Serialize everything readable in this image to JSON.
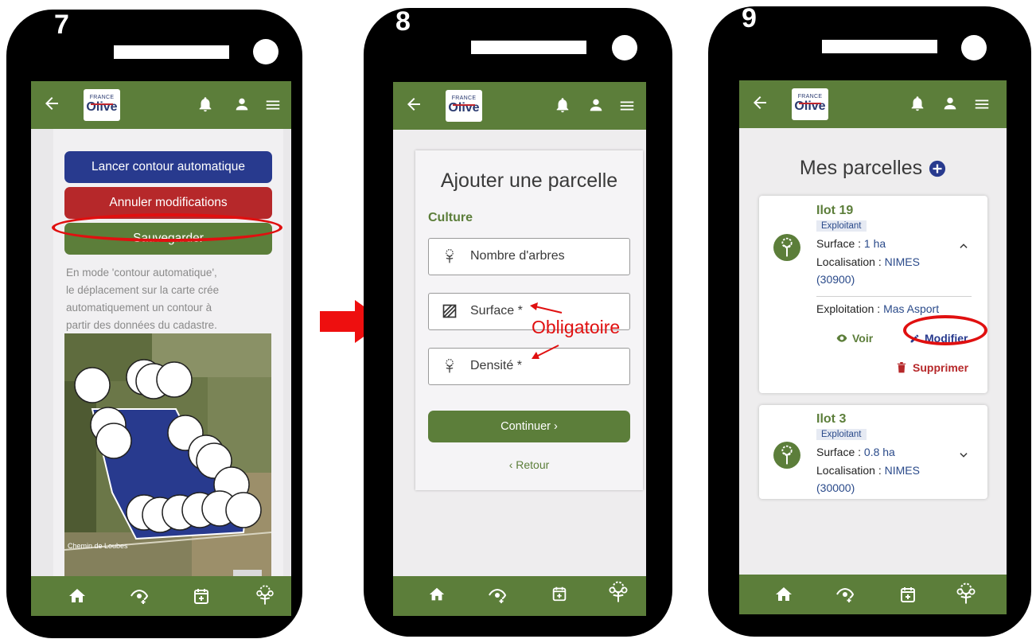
{
  "steps": [
    "7",
    "8",
    "9"
  ],
  "colors": {
    "green": "#5c7e3a",
    "blue": "#283a8e",
    "red": "#b6282a",
    "annotation_red": "#e01010"
  },
  "brand": {
    "small": "FRANCE",
    "big": "Olive"
  },
  "topbar_icons": [
    "back-arrow-icon",
    "logo",
    "bell-icon",
    "user-icon",
    "menu-icon"
  ],
  "bottombar_icons": [
    "home-icon",
    "eye-plus-icon",
    "calendar-plus-icon",
    "tree-icon"
  ],
  "screen7": {
    "btn_auto": "Lancer contour automatique",
    "btn_cancel": "Annuler modifications",
    "btn_save": "Sauvegarder",
    "help_lines": [
      "En mode 'contour automatique',",
      "le déplacement sur la carte crée",
      "automatiquement un contour à",
      "partir des données du cadastre."
    ],
    "map_road": "Chemin de Loubes"
  },
  "screen8": {
    "title": "Ajouter une parcelle",
    "section": "Culture",
    "fields": [
      "Nombre d'arbres",
      "Surface *",
      "Densité *"
    ],
    "continue": "Continuer  ›",
    "back": "‹  Retour",
    "annotation": "Obligatoire"
  },
  "screen9": {
    "title": "Mes parcelles",
    "parcels": [
      {
        "name": "Ilot 19",
        "badge": "Exploitant",
        "surface_label": "Surface : ",
        "surface": "1 ha",
        "loc_label": "Localisation : ",
        "loc": "NIMES",
        "postal": "(30900)",
        "exploitation_label": "Exploitation : ",
        "exploitation": "Mas Asport",
        "view": "Voir",
        "edit": "Modifier",
        "delete": "Supprimer"
      },
      {
        "name": "Ilot 3",
        "badge": "Exploitant",
        "surface_label": "Surface : ",
        "surface": "0.8 ha",
        "loc_label": "Localisation : ",
        "loc": "NIMES",
        "postal": "(30000)"
      }
    ]
  }
}
